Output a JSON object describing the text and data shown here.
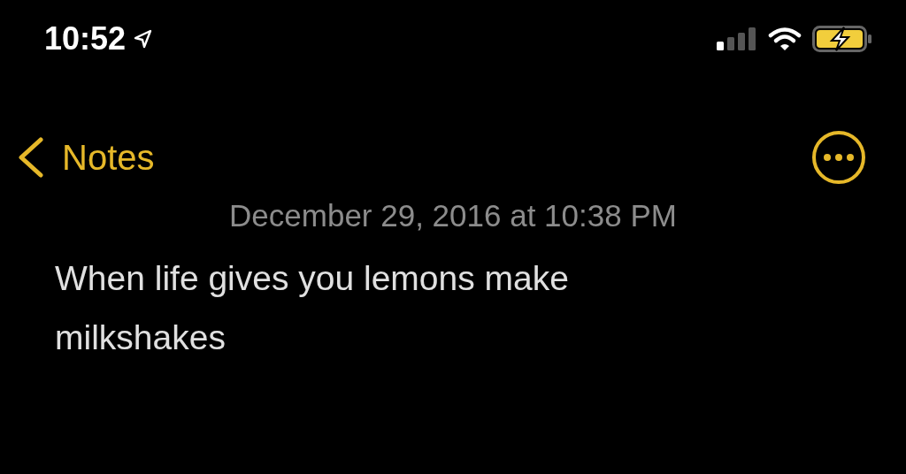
{
  "status_bar": {
    "time": "10:52",
    "battery_charging": true
  },
  "nav": {
    "back_label": "Notes"
  },
  "note": {
    "date": "December 29, 2016 at 10:38 PM",
    "body": "When life gives you lemons make milkshakes"
  }
}
